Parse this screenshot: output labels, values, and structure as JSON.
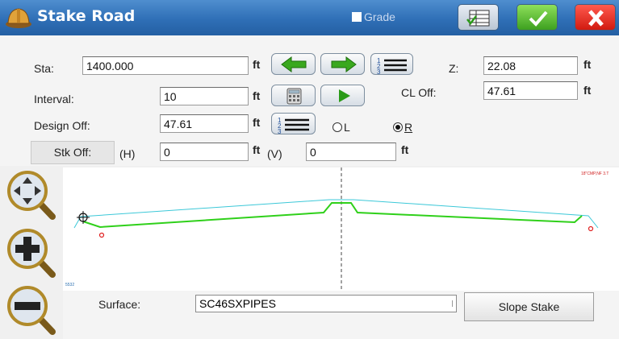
{
  "window": {
    "title": "Stake Road",
    "grade_label": "Grade",
    "grade_checked": false
  },
  "fields": {
    "sta": {
      "label": "Sta:",
      "value": "1400.000",
      "unit": "ft"
    },
    "z": {
      "label": "Z:",
      "value": "22.08",
      "unit": "ft"
    },
    "interval": {
      "label": "Interval:",
      "value": "10",
      "unit": "ft"
    },
    "cl_off": {
      "label": "CL Off:",
      "value": "47.61",
      "unit": "ft"
    },
    "design_off": {
      "label": "Design Off:",
      "value": "47.61",
      "unit": "ft"
    },
    "stk_off": {
      "button_label": "Stk Off:",
      "h_label": "(H)",
      "h_value": "0",
      "h_unit": "ft",
      "v_label": "(V)",
      "v_value": "0",
      "v_unit": "ft"
    }
  },
  "side": {
    "left_label": "L",
    "right_label": "R",
    "selected": "R"
  },
  "surface": {
    "label": "Surface:",
    "value": "SC46SXPIPES"
  },
  "buttons": {
    "slope_stake": "Slope Stake"
  },
  "canvas": {
    "corner_label": "18\"CMP,NF 3.T",
    "corner_label_left": "5532"
  },
  "colors": {
    "titlebar": "#2f6fb6",
    "design_line": "#2fd01a",
    "surface_line": "#3cc8d8",
    "centerline": "#444444",
    "ok": "#3da020",
    "cancel": "#d11a10"
  }
}
